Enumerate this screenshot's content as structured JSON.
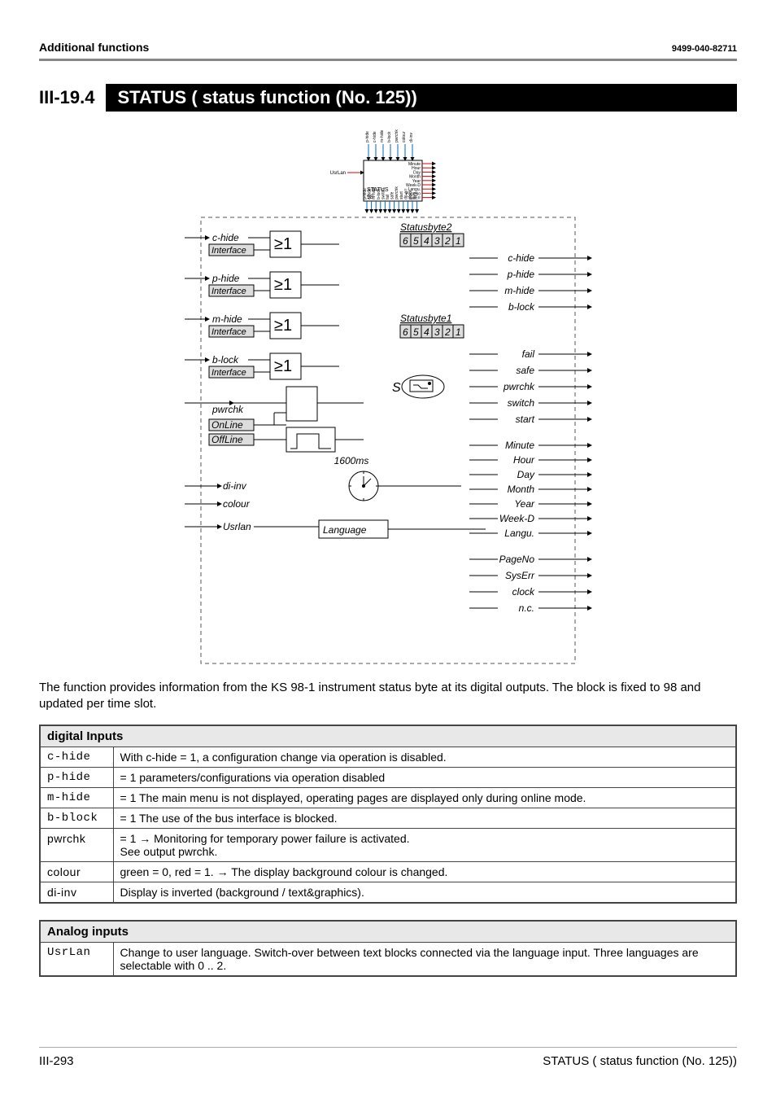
{
  "header": {
    "left": "Additional functions",
    "right": "9499-040-82711"
  },
  "section": {
    "num": "III-19.4",
    "title": "STATUS ( status function (No. 125))"
  },
  "small_block": {
    "name": "STATUS",
    "num": "98",
    "top_inputs": [
      "p-hide",
      "c-hide",
      "m-hide",
      "b-lock",
      "pwrchk",
      "colour",
      "di-inv"
    ],
    "left_input": "UsrLan",
    "bot_outputs": [
      "p-hide",
      "c-hide",
      "m-hide",
      "b-lock",
      "switch",
      "fail",
      "safe",
      "pwrchk",
      "start",
      "dp-err",
      "clock",
      "fkey"
    ],
    "right_outputs": [
      "Minute",
      "Hour",
      "Day",
      "Month",
      "Year",
      "Week-D",
      "Langu.",
      "PageNo",
      "SysErr"
    ]
  },
  "diagram": {
    "inputs_left": [
      "c-hide",
      "p-hide",
      "m-hide",
      "b-lock",
      "pwrchk",
      "di-inv",
      "colour",
      "Usrlan"
    ],
    "interface_label": "Interface",
    "online_label": "OnLine",
    "offline_label": "OffLine",
    "or_symbol": "≥1",
    "statusbyte2": "Statusbyte2",
    "statusbyte1": "Statusbyte1",
    "byte_digits": [
      "6",
      "5",
      "4",
      "3",
      "2",
      "1"
    ],
    "s_label": "S",
    "language_label": "Language",
    "delay_label": "1600ms",
    "outputs_right_top": [
      "c-hide",
      "p-hide",
      "m-hide",
      "b-lock"
    ],
    "outputs_right_mid": [
      "fail",
      "safe",
      "pwrchk",
      "switch",
      "start"
    ],
    "outputs_right_time": [
      "Minute",
      "Hour",
      "Day",
      "Month",
      "Year",
      "Week-D",
      "Langu."
    ],
    "outputs_right_bot": [
      "PageNo",
      "SysErr",
      "clock",
      "n.c."
    ]
  },
  "bodytext": "The function provides information from the KS 98-1 instrument status byte at its digital outputs. The block is fixed to 98 and updated per time slot.",
  "tables": {
    "digital": {
      "header": "digital Inputs",
      "rows": [
        {
          "k": "c-hide",
          "v": "With c-hide = 1, a configuration change via operation is disabled."
        },
        {
          "k": "p-hide",
          "v": "= 1 parameters/configurations via operation disabled"
        },
        {
          "k": "m-hide",
          "v": "= 1 The main menu is not displayed, operating pages are displayed only during online mode."
        },
        {
          "k": "b-block",
          "v": "= 1 The use of the bus interface is blocked."
        },
        {
          "k": "pwrchk",
          "v": "= 1 → Monitoring for temporary power failure is activated.\n      See output pwrchk."
        },
        {
          "k": "colour",
          "v": "green = 0, red = 1. → The display background colour is changed."
        },
        {
          "k": "di-inv",
          "v": "Display is inverted (background / text&graphics)."
        }
      ]
    },
    "analog": {
      "header": "Analog inputs",
      "rows": [
        {
          "k": "UsrLan",
          "v": "Change to user language. Switch-over between text blocks connected via the language input. Three languages are selectable with 0 .. 2."
        }
      ]
    }
  },
  "footer": {
    "left": "III-293",
    "right": "STATUS ( status function (No. 125))"
  }
}
